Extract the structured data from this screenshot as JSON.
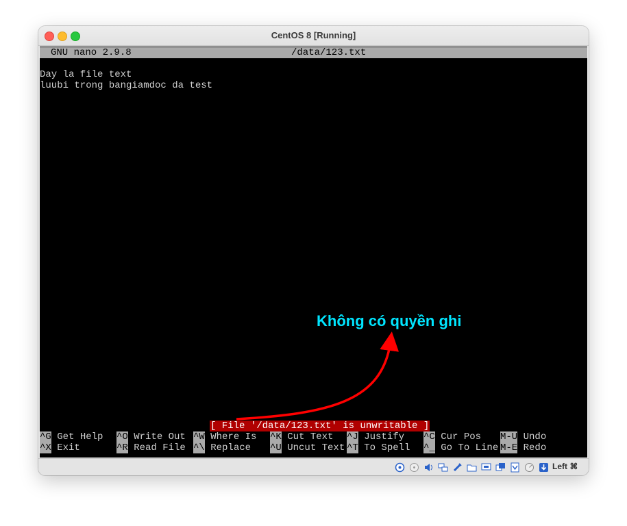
{
  "window": {
    "title": "CentOS 8 [Running]"
  },
  "nano": {
    "app_version": "GNU nano 2.9.8",
    "file_path": "/data/123.txt",
    "lines": [
      "Day la file text",
      "luubi trong bangiamdoc da test"
    ],
    "status_message": "[ File '/data/123.txt' is unwritable ]",
    "shortcuts": [
      {
        "key": "^G",
        "label": "Get Help"
      },
      {
        "key": "^O",
        "label": "Write Out"
      },
      {
        "key": "^W",
        "label": "Where Is"
      },
      {
        "key": "^K",
        "label": "Cut Text"
      },
      {
        "key": "^J",
        "label": "Justify"
      },
      {
        "key": "^C",
        "label": "Cur Pos"
      },
      {
        "key": "M-U",
        "label": "Undo"
      },
      {
        "key": "^X",
        "label": "Exit"
      },
      {
        "key": "^R",
        "label": "Read File"
      },
      {
        "key": "^\\",
        "label": "Replace"
      },
      {
        "key": "^U",
        "label": "Uncut Text"
      },
      {
        "key": "^T",
        "label": "To Spell"
      },
      {
        "key": "^_",
        "label": "Go To Line"
      },
      {
        "key": "M-E",
        "label": "Redo"
      }
    ]
  },
  "annotation": {
    "text": "Không có quyền ghi",
    "color": "#00e5ff",
    "arrow_color": "#ff0000"
  },
  "status_bar": {
    "icons": [
      "hard-disk-icon",
      "optical-drive-icon",
      "audio-icon",
      "network-icon",
      "usb-icon",
      "shared-folder-icon",
      "display-icon",
      "video-capture-icon",
      "cpu-icon",
      "mouse-integration-icon",
      "keyboard-capture-icon"
    ],
    "host_key_label": "Left ⌘"
  },
  "colors": {
    "terminal_bg": "#000000",
    "header_bg": "#aaaaaa",
    "error_bg": "#b00000"
  }
}
